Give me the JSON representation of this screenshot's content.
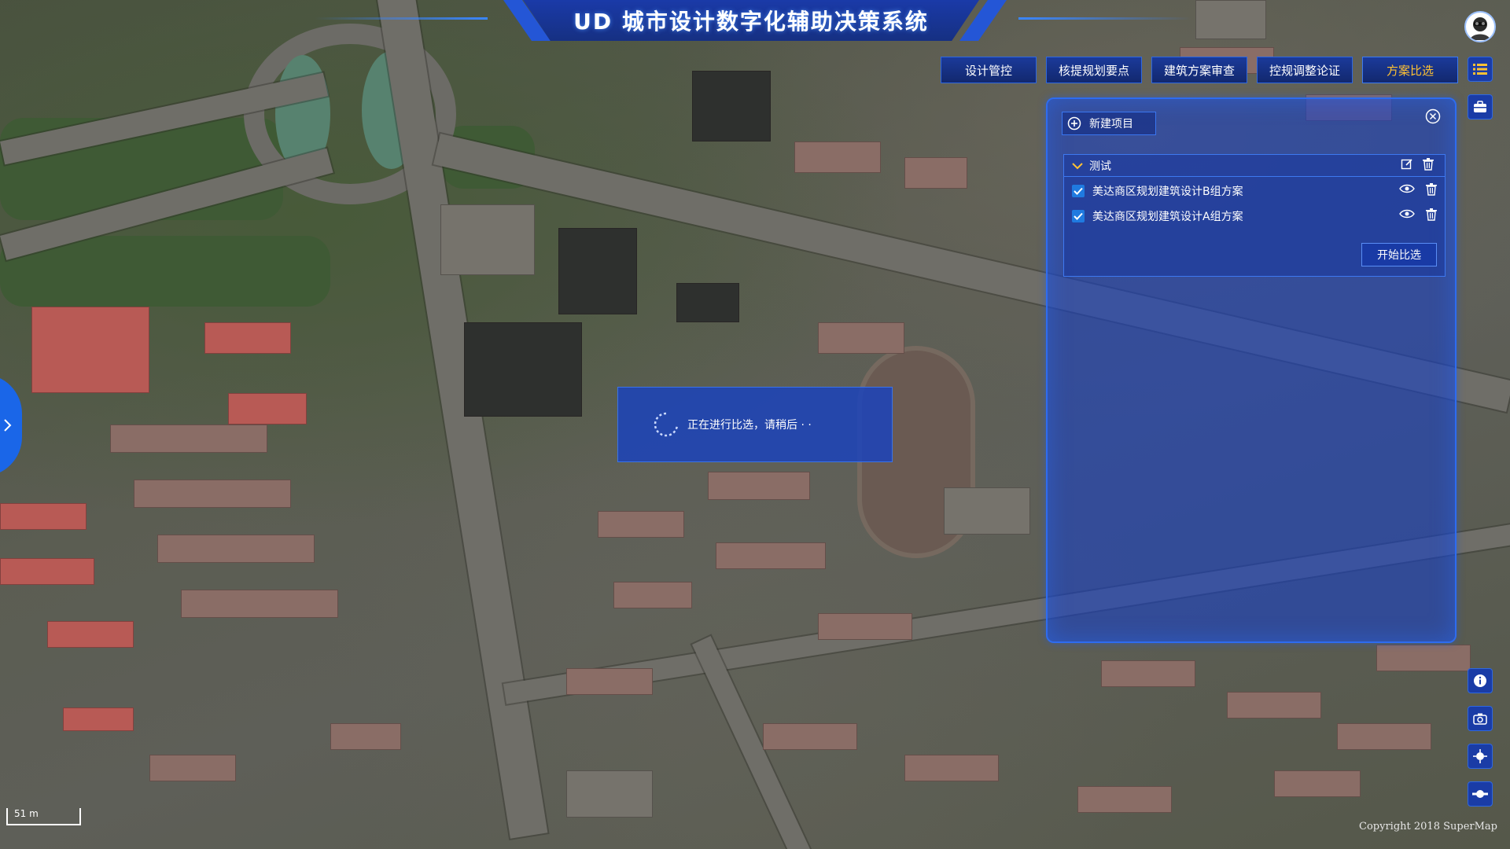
{
  "header": {
    "title": "UD 城市设计数字化辅助决策系统"
  },
  "nav": {
    "items": [
      {
        "label": "设计管控",
        "active": false
      },
      {
        "label": "核提规划要点",
        "active": false
      },
      {
        "label": "建筑方案审查",
        "active": false
      },
      {
        "label": "控规调整论证",
        "active": false
      },
      {
        "label": "方案比选",
        "active": true
      }
    ]
  },
  "side_icons": [
    "list-icon",
    "toolbox-icon",
    "info-icon",
    "camera-icon",
    "locate-icon",
    "eye-toggle-icon"
  ],
  "panel": {
    "new_project_label": "新建项目",
    "group": {
      "name": "测试",
      "items": [
        {
          "label": "美达商区规划建筑设计B组方案",
          "checked": true
        },
        {
          "label": "美达商区规划建筑设计A组方案",
          "checked": true
        }
      ],
      "compare_label": "开始比选"
    }
  },
  "loading": {
    "message": "正在进行比选，请稍后 · ·"
  },
  "map": {
    "scale_label": "51 m",
    "copyright": "Copyright 2018 SuperMap"
  },
  "colors": {
    "accent": "#2e6cf0",
    "active_nav": "#ffc233",
    "panel_bg": "#1640c8"
  }
}
